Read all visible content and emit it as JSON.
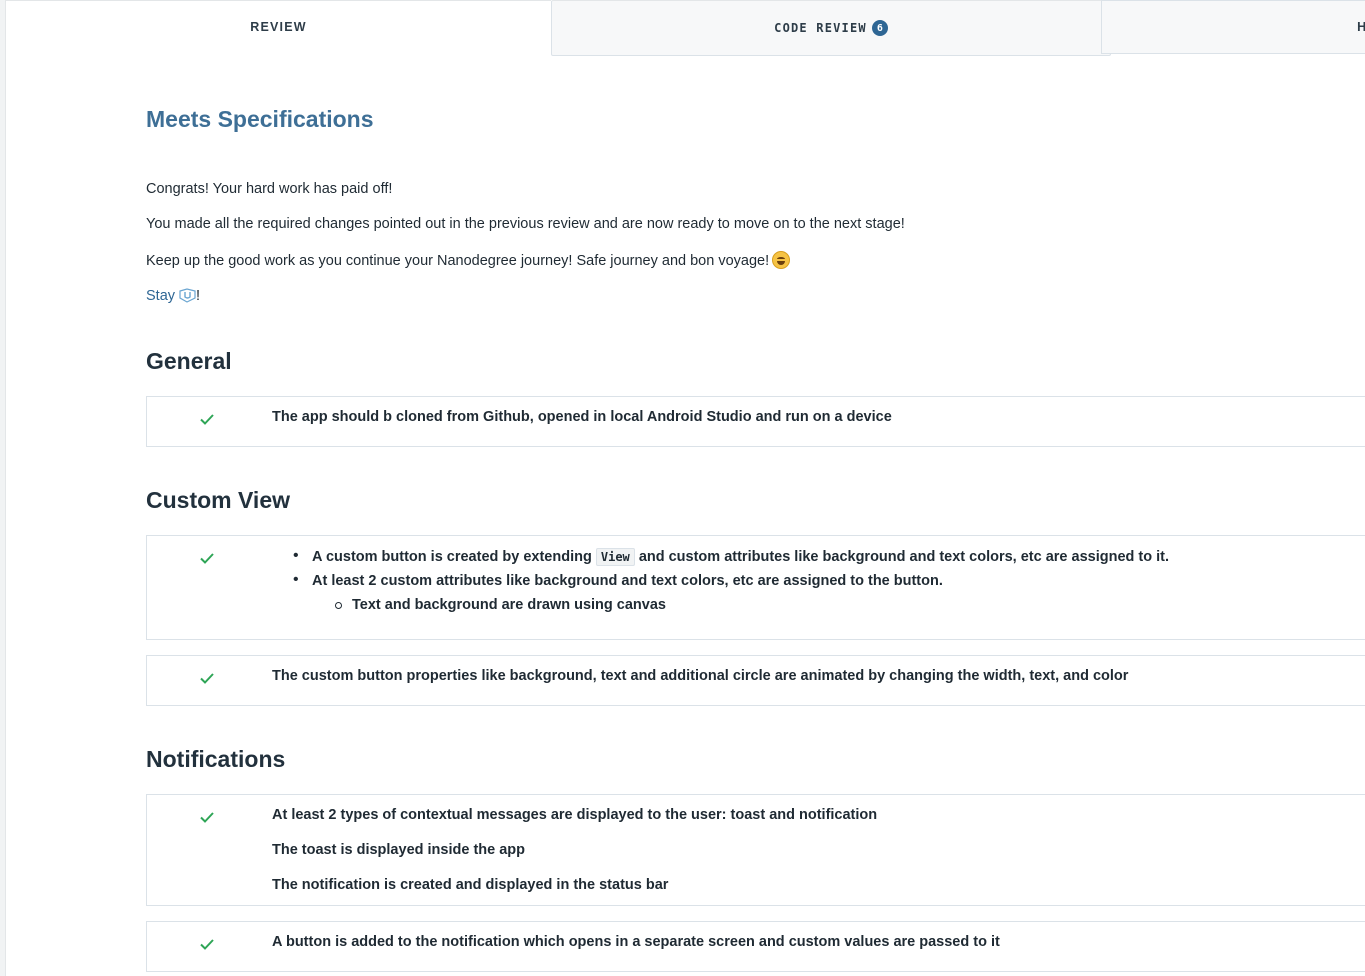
{
  "tabs": {
    "review": "REVIEW",
    "code_review": "CODE REVIEW",
    "code_review_count": "6",
    "history": "HI"
  },
  "review": {
    "title": "Meets Specifications",
    "paragraphs": [
      "Congrats! Your hard work has paid off!",
      "You made all the required changes pointed out in the previous review and are now ready to move on to the next stage!",
      "Keep up the good work as you continue your Nanodegree journey! Safe journey and bon voyage!"
    ],
    "stay_link": "Stay",
    "stay_suffix": "!"
  },
  "sections": {
    "general": {
      "heading": "General",
      "criteria": [
        "The app should b cloned from Github, opened in local Android Studio and run on a device"
      ]
    },
    "custom_view": {
      "heading": "Custom View",
      "item1_prefix": "A custom button is created by extending",
      "item1_code": "View",
      "item1_suffix": "and custom attributes like background and text colors, etc are assigned to it.",
      "item2": "At least 2 custom attributes like background and text colors, etc are assigned to the button.",
      "item2_sub": "Text and background are drawn using canvas",
      "criterion2": "The custom button properties like background, text and additional circle are animated by changing the width, text, and color"
    },
    "notifications": {
      "heading": "Notifications",
      "lines": [
        "At least 2 types of contextual messages are displayed to the user: toast and notification",
        "The toast is displayed inside the app",
        "The notification is created and displayed in the status bar"
      ],
      "criterion2": "A button is added to the notification which opens in a separate screen and custom values are passed to it"
    }
  },
  "colors": {
    "accent": "#3e6f96",
    "check": "#2ea556",
    "badge": "#2e6694"
  },
  "icons": {
    "check": "check-icon",
    "emoji": "grinning-face-icon",
    "udacity": "udacity-logo-icon"
  }
}
